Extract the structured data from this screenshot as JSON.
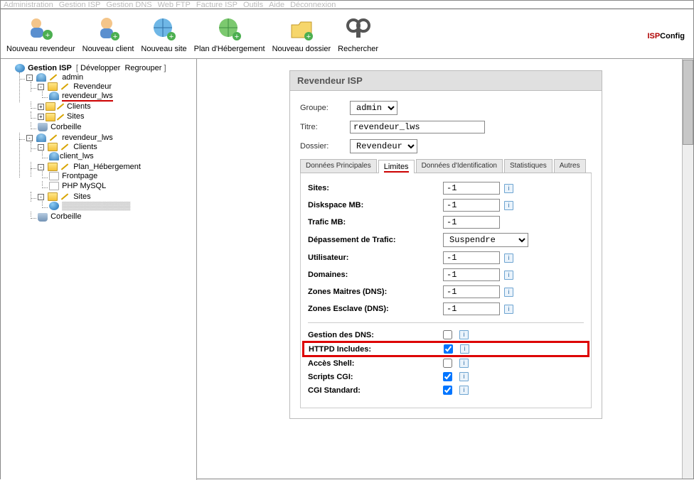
{
  "menu": {
    "items": [
      "Administration",
      "Gestion ISP",
      "Gestion DNS",
      "Web FTP",
      "Facture ISP",
      "Outils",
      "Aide",
      "Déconnexion"
    ]
  },
  "tools": {
    "nouveau_revendeur": "Nouveau revendeur",
    "nouveau_client": "Nouveau client",
    "nouveau_site": "Nouveau site",
    "plan_heberg": "Plan d'Hébergement",
    "nouveau_dossier": "Nouveau dossier",
    "rechercher": "Rechercher"
  },
  "brand": {
    "isp": "ISP",
    "config": "Config"
  },
  "tree": {
    "root": "Gestion ISP",
    "links": [
      "Développer",
      "Regrouper"
    ],
    "admin": "admin",
    "revendeur": "Revendeur",
    "revendeur_lws": "revendeur_lws",
    "clients": "Clients",
    "sites": "Sites",
    "corbeille": "Corbeille",
    "revendeur_lws2": "revendeur_lws",
    "client_lws": "client_lws",
    "plan_heberg": "Plan_Hébergement",
    "frontpage": "Frontpage",
    "php_mysql": "PHP MySQL"
  },
  "panel": {
    "title": "Revendeur ISP",
    "groupe": {
      "label": "Groupe:",
      "value": "admin"
    },
    "titre": {
      "label": "Titre:",
      "value": "revendeur_lws"
    },
    "dossier": {
      "label": "Dossier:",
      "value": "Revendeur"
    },
    "tabs": [
      "Données Principales",
      "Limites",
      "Données d'Identification",
      "Statistiques",
      "Autres"
    ],
    "fields": {
      "sites": {
        "label": "Sites:",
        "value": "-1"
      },
      "diskspace": {
        "label": "Diskspace MB:",
        "value": "-1"
      },
      "trafic": {
        "label": "Trafic MB:",
        "value": "-1"
      },
      "depassement": {
        "label": "Dépassement de Trafic:",
        "value": "Suspendre"
      },
      "utilisateur": {
        "label": "Utilisateur:",
        "value": "-1"
      },
      "domaines": {
        "label": "Domaines:",
        "value": "-1"
      },
      "zones_m": {
        "label": "Zones Maitres (DNS):",
        "value": "-1"
      },
      "zones_e": {
        "label": "Zones Esclave (DNS):",
        "value": "-1"
      }
    },
    "checks": {
      "gestion_dns": {
        "label": "Gestion des DNS:",
        "checked": false
      },
      "httpd": {
        "label": "HTTPD Includes:",
        "checked": true
      },
      "shell": {
        "label": "Accès Shell:",
        "checked": false
      },
      "cgi": {
        "label": "Scripts CGI:",
        "checked": true
      },
      "cgi_std": {
        "label": "CGI Standard:",
        "checked": true
      }
    }
  }
}
